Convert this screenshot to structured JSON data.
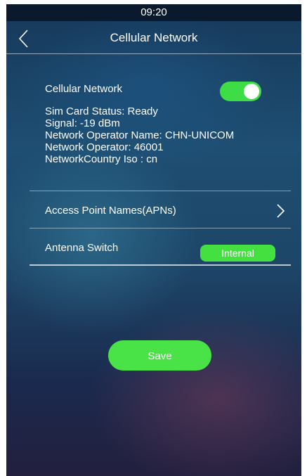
{
  "status_bar": {
    "time": "09:20"
  },
  "header": {
    "title": "Cellular Network",
    "back_icon": "chevron-left-icon"
  },
  "cellular": {
    "label": "Cellular Network",
    "toggle_on": true,
    "sim_card_status": "Sim Card Status:  Ready",
    "signal": "Signal:  -19 dBm",
    "network_operator_name": "Network Operator Name:  CHN-UNICOM",
    "network_operator": "Network Operator:  46001",
    "network_country_iso": "NetworkCountry Iso :  cn"
  },
  "apn": {
    "label": "Access Point Names(APNs)",
    "icon": "chevron-right-icon"
  },
  "antenna": {
    "label": "Antenna Switch",
    "value": "Internal"
  },
  "actions": {
    "save_label": "Save"
  },
  "colors": {
    "accent": "#43e03f",
    "background": "#1e4e72"
  }
}
